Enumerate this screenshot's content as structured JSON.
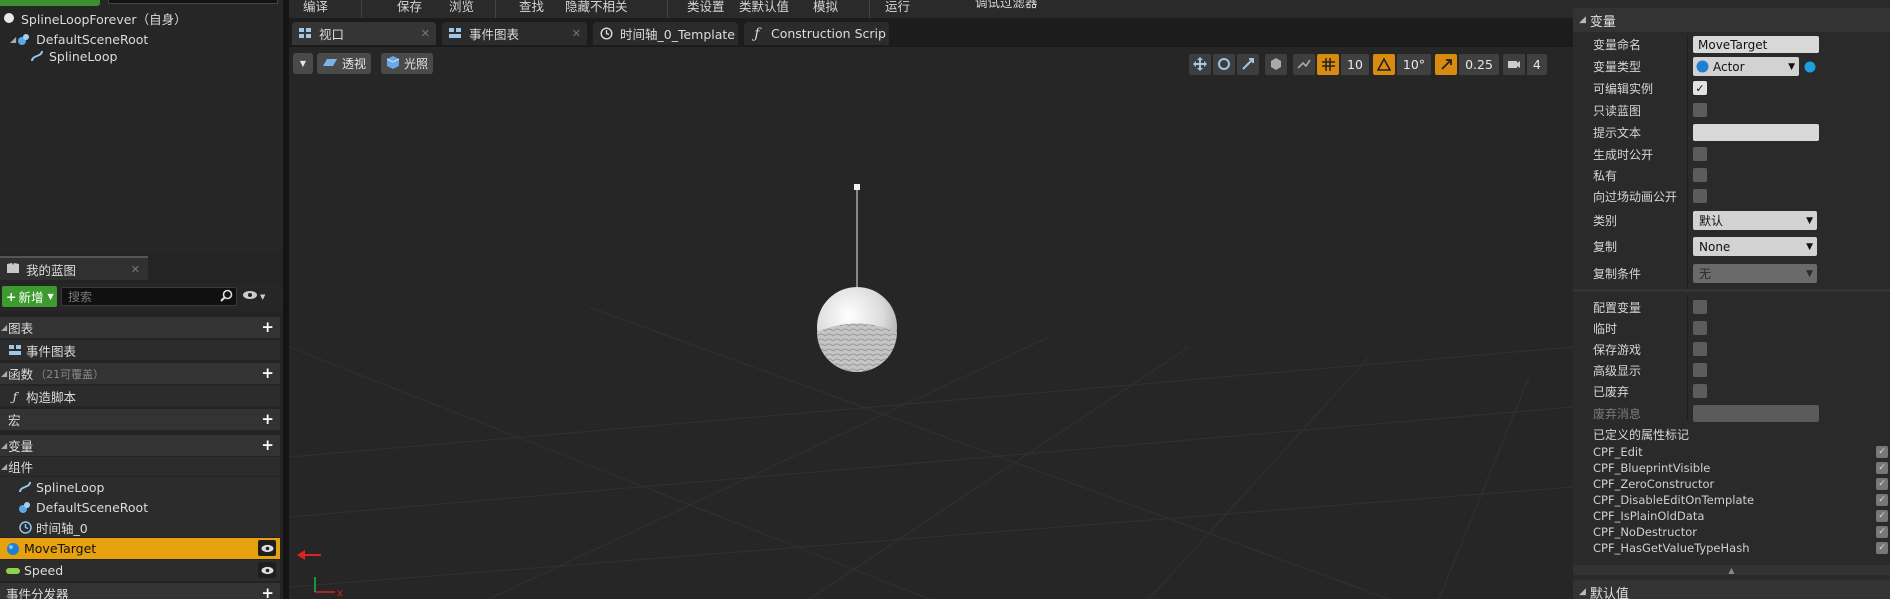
{
  "components": {
    "root_item": "SplineLoopForever（自身）",
    "children": [
      "DefaultSceneRoot",
      "SplineLoop"
    ]
  },
  "my_blueprint": {
    "tab_label": "我的蓝图",
    "new_label": "新增",
    "search_placeholder": "搜索",
    "graphs_label": "图表",
    "event_graph_label": "事件图表",
    "functions_label": "函数",
    "functions_count": "（21可覆盖）",
    "construction_label": "构造脚本",
    "macros_label": "宏",
    "variables_label": "变量",
    "components_group_label": "组件",
    "component_vars": [
      "SplineLoop",
      "DefaultSceneRoot",
      "时间轴_0"
    ],
    "selected_var": "MoveTarget",
    "other_var": "Speed",
    "dispatchers_label": "事件分发器"
  },
  "toolbar": {
    "compile": "编译",
    "save": "保存",
    "browse": "浏览",
    "find": "查找",
    "hide_unrelated": "隐藏不相关",
    "class_settings": "类设置",
    "class_defaults": "类默认值",
    "simulate": "模拟",
    "run": "运行",
    "debug_filter": "调试过滤器"
  },
  "tabs": [
    {
      "label": "视口"
    },
    {
      "label": "事件图表"
    },
    {
      "label": "时间轴_0_Template"
    },
    {
      "label": "Construction Scrip"
    }
  ],
  "viewport": {
    "perspective": "透视",
    "lit": "光照",
    "grid_snap": "10",
    "rot_snap": "10°",
    "scale_snap": "0.25",
    "cam_speed": "4"
  },
  "details": {
    "section_variable": "变量",
    "labels": {
      "var_name": "变量命名",
      "var_type": "变量类型",
      "instance_editable": "可编辑实例",
      "bp_readonly": "只读蓝图",
      "tooltip": "提示文本",
      "expose_spawn": "生成时公开",
      "private": "私有",
      "expose_cinematics": "向过场动画公开",
      "category": "类别",
      "replication": "复制",
      "rep_condition": "复制条件",
      "config_var": "配置变量",
      "transient": "临时",
      "save_game": "保存游戏",
      "advanced_display": "高级显示",
      "deprecated": "已废弃",
      "deprecation_msg": "废弃消息",
      "defined_flags": "已定义的属性标记"
    },
    "values": {
      "var_name": "MoveTarget",
      "var_type": "Actor",
      "category": "默认",
      "replication": "None",
      "rep_condition": "无"
    },
    "checks": {
      "instance_editable": true,
      "bp_readonly": false,
      "expose_spawn": false,
      "private": false,
      "expose_cinematics": false,
      "config_var": false,
      "transient": false,
      "save_game": false,
      "advanced_display": false,
      "deprecated": false
    },
    "flags": [
      "CPF_Edit",
      "CPF_BlueprintVisible",
      "CPF_ZeroConstructor",
      "CPF_DisableEditOnTemplate",
      "CPF_IsPlainOldData",
      "CPF_NoDestructor",
      "CPF_HasGetValueTypeHash"
    ],
    "section_default": "默认值"
  },
  "colors": {
    "accent_selected": "#e6a10e",
    "new_button": "#3d9a2e",
    "actor_type": "#1f7fd1",
    "snap_active": "#d98b10"
  }
}
